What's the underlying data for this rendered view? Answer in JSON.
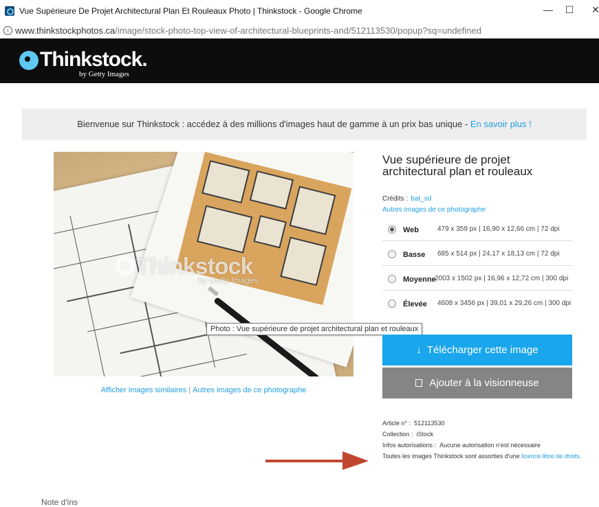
{
  "window": {
    "title": "Vue Supérieure De Projet Architectural Plan Et Rouleaux Photo | Thinkstock - Google Chrome",
    "minimize": "—",
    "maximize": "☐",
    "close": "✕"
  },
  "address": {
    "info_glyph": "i",
    "domain": "www.thinkstockphotos.ca",
    "path": "/image/stock-photo-top-view-of-architectural-blueprints-and/512113530/popup?sq=undefined"
  },
  "header": {
    "logo_text": "Thinkstock.",
    "logo_sub": "by Getty Images"
  },
  "banner": {
    "text": "Bienvenue sur Thinkstock : accédez à des millions d'images haut de gamme à un prix bas unique - ",
    "link": "En savoir plus !"
  },
  "photo": {
    "watermark": "Thinkstock",
    "watermark_sub": "by Getty Images",
    "tooltip": "Photo : Vue supérieure de projet architectural plan et rouleaux"
  },
  "photo_links": {
    "similar": "Afficher images similaires",
    "separator": "|",
    "more": "Autres images de ce photographe"
  },
  "detail": {
    "title": "Vue supérieure de projet architectural plan et rouleaux",
    "credits_label": "Crédits :",
    "credits_value": "bat_sd",
    "more_photographer": "Autres images de ce photographe",
    "sizes": [
      {
        "name": "Web",
        "dims": "479 x 359 px | 16,90 x 12,66 cm | 72 dpi",
        "selected": true
      },
      {
        "name": "Basse",
        "dims": "685 x 514 px | 24,17 x 18,13 cm | 72 dpi",
        "selected": false
      },
      {
        "name": "Moyenne",
        "dims": "2003 x 1502 px | 16,96 x 12,72 cm | 300 dpi",
        "selected": false
      },
      {
        "name": "Élevée",
        "dims": "4608 x 3456 px | 39,01 x 29,26 cm | 300 dpi",
        "selected": false
      }
    ],
    "download_icon": "↓",
    "download_label": "Télécharger cette image",
    "lightbox_label": "Ajouter à la visionneuse",
    "article_label": "Article n° :",
    "article_value": "512113530",
    "collection_label": "Collection :",
    "collection_value": "iStock",
    "rights_label": "Infos autorisations :",
    "rights_value": "Aucune autorisation n'est nécessaire",
    "license_text": "Toutes les images Thinkstock sont assorties d'une ",
    "license_link": "licence libre de droits."
  },
  "footer": {
    "partial": "Note d'ins"
  },
  "colors": {
    "accent": "#19a6ec",
    "header_bg": "#0d0d0d",
    "lightbox_bg": "#858585",
    "arrow": "#c0472f"
  }
}
